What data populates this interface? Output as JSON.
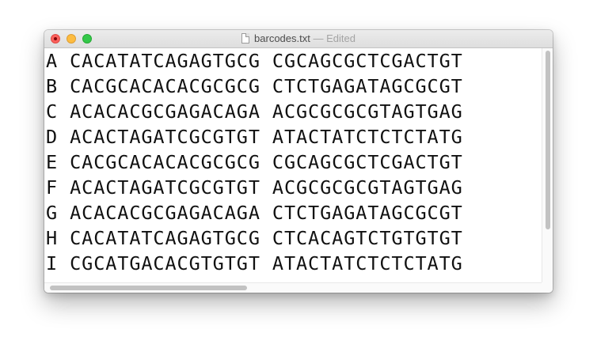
{
  "window": {
    "filename": "barcodes.txt",
    "edited_suffix": " — Edited",
    "icon": "document-icon"
  },
  "colors": {
    "close": "#fc605c",
    "minimize": "#fdbc40",
    "maximize": "#34c84a",
    "text": "#111111"
  },
  "lines": [
    "A CACATATCAGAGTGCG CGCAGCGCTCGACTGT",
    "B CACGCACACACGCGCG CTCTGAGATAGCGCGT",
    "C ACACACGCGAGACAGA ACGCGCGCGTAGTGAG",
    "D ACACTAGATCGCGTGT ATACTATCTCTCTATG",
    "E CACGCACACACGCGCG CGCAGCGCTCGACTGT",
    "F ACACTAGATCGCGTGT ACGCGCGCGTAGTGAG",
    "G ACACACGCGAGACAGA CTCTGAGATAGCGCGT",
    "H CACATATCAGAGTGCG CTCACAGTCTGTGTGT",
    "I CGCATGACACGTGTGT ATACTATCTCTCTATG"
  ]
}
